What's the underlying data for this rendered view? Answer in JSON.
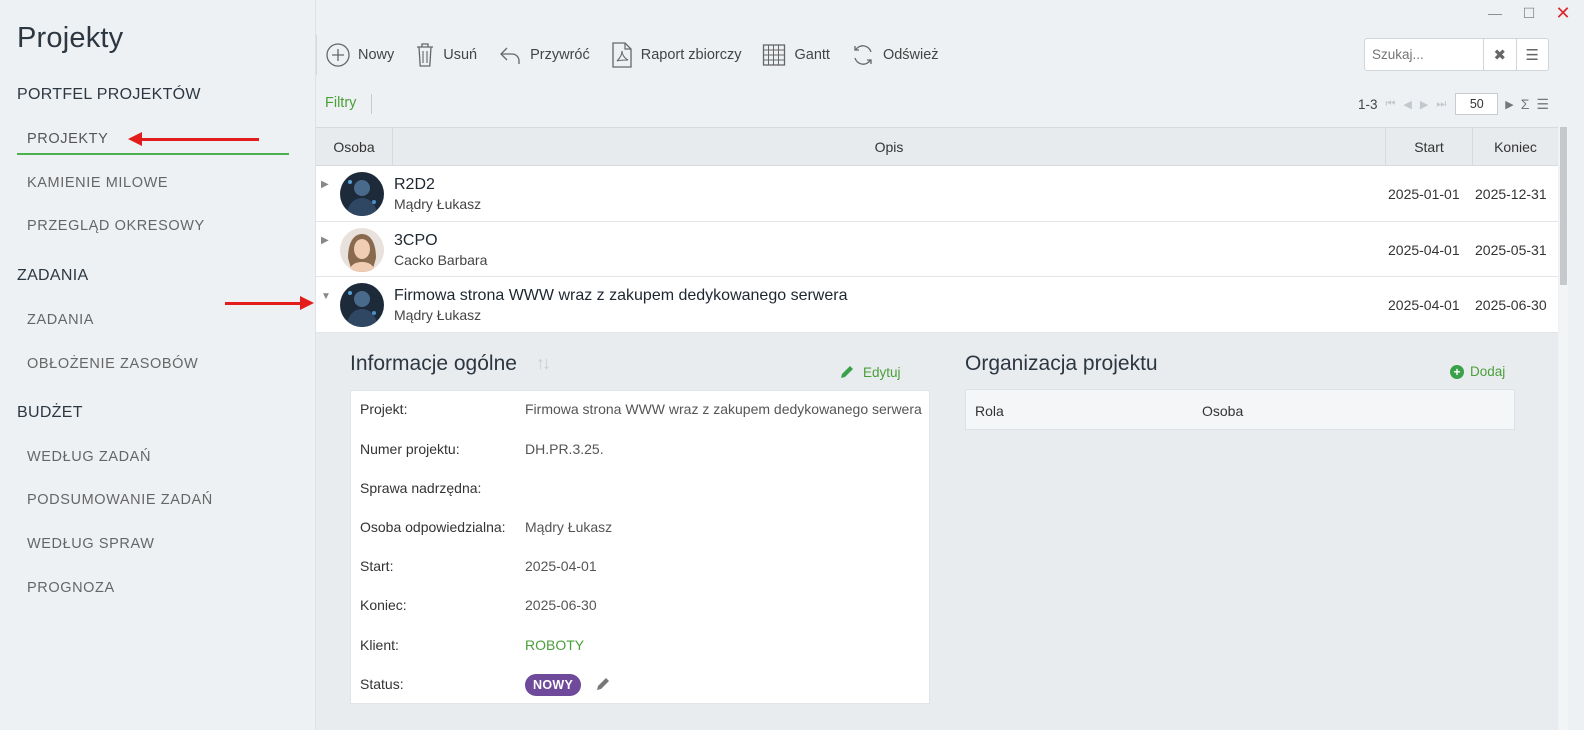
{
  "window": {
    "minimize": "—",
    "maximize": "☐",
    "close": "✕"
  },
  "app": {
    "title": "Projekty"
  },
  "sidebar": {
    "sections": [
      {
        "heading": "PORTFEL PROJEKTÓW",
        "items": [
          "PROJEKTY",
          "KAMIENIE MILOWE",
          "PRZEGLĄD OKRESOWY"
        ]
      },
      {
        "heading": "ZADANIA",
        "items": [
          "ZADANIA",
          "OBŁOŻENIE ZASOBÓW"
        ]
      },
      {
        "heading": "BUDŻET",
        "items": [
          "WEDŁUG ZADAŃ",
          "PODSUMOWANIE ZADAŃ",
          "WEDŁUG SPRAW",
          "PROGNOZA"
        ]
      }
    ],
    "active_item": "PROJEKTY"
  },
  "toolbar": {
    "new": "Nowy",
    "delete": "Usuń",
    "restore": "Przywróć",
    "report": "Raport zbiorczy",
    "gantt": "Gantt",
    "refresh": "Odśwież"
  },
  "search": {
    "placeholder": "Szukaj...",
    "clear": "✖",
    "menu": "☰"
  },
  "filters": {
    "label": "Filtry"
  },
  "pager": {
    "range": "1-3",
    "page_size": "50",
    "sum": "Σ",
    "menu": "☰"
  },
  "grid": {
    "columns": [
      "Osoba",
      "Opis",
      "Start",
      "Koniec"
    ],
    "rows": [
      {
        "name": "R2D2",
        "person": "Mądry Łukasz",
        "start": "2025-01-01",
        "end": "2025-12-31",
        "expanded": false
      },
      {
        "name": "3CPO",
        "person": "Cacko Barbara",
        "start": "2025-04-01",
        "end": "2025-05-31",
        "expanded": false
      },
      {
        "name": "Firmowa strona WWW wraz z zakupem dedykowanego serwera",
        "person": "Mądry Łukasz",
        "start": "2025-04-01",
        "end": "2025-06-30",
        "expanded": true
      }
    ]
  },
  "info": {
    "heading": "Informacje ogólne",
    "edit": "Edytuj",
    "fields": [
      {
        "label": "Projekt:",
        "value": "Firmowa strona WWW wraz z zakupem dedykowanego serwera"
      },
      {
        "label": "Numer projektu:",
        "value": "DH.PR.3.25."
      },
      {
        "label": "Sprawa nadrzędna:",
        "value": ""
      },
      {
        "label": "Osoba odpowiedzialna:",
        "value": "Mądry Łukasz"
      },
      {
        "label": "Start:",
        "value": "2025-04-01"
      },
      {
        "label": "Koniec:",
        "value": "2025-06-30"
      },
      {
        "label": "Klient:",
        "value": "ROBOTY"
      },
      {
        "label": "Status:",
        "value": "NOWY"
      }
    ]
  },
  "organization": {
    "heading": "Organizacja projektu",
    "add": "Dodaj",
    "columns": [
      "Rola",
      "Osoba"
    ]
  },
  "colors": {
    "accent_green": "#4a9f3a",
    "status_badge": "#6f4a9b",
    "annotation_red": "#e31c1c"
  }
}
